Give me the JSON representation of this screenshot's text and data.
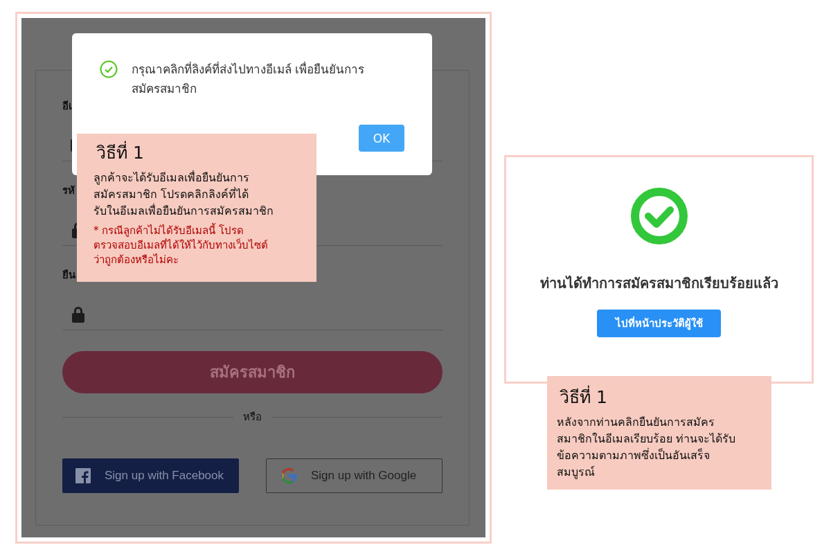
{
  "left_screenshot": {
    "form": {
      "fields": [
        {
          "label": "อีเ",
          "kind": "email"
        },
        {
          "label": "รหั",
          "kind": "password"
        },
        {
          "label": "ยืน",
          "kind": "password"
        }
      ],
      "submit_button": "สมัครสมาชิก",
      "divider_text": "หรือ",
      "social_buttons": [
        {
          "kind": "facebook",
          "label": "Sign up with Facebook"
        },
        {
          "kind": "google",
          "label": "Sign up with Google"
        }
      ]
    },
    "modal": {
      "message": "กรุณาคลิกที่ลิงค์ที่ส่งไปทางอีเมล์ เพื่อยืนยันการ\nสมัครสมาชิก",
      "ok_button": "OK"
    },
    "annotation": {
      "title": "วิธีที่ 1",
      "body": "ลูกค้าจะได้รับอีเมลเพื่อยืนยันการ\nสมัครสมาชิก โปรดคลิกลิงค์ที่ได้\nรับในอีเมลเพื่อยืนยันการสมัครสมาชิก",
      "note": "* กรณีลูกค้าไม่ได้รับอีเมลนี้ โปรด\nตรวจสอบอีเมลที่ได้ให้ไว้กับทางเว็บไซต์\nว่าถูกต้องหรือไม่คะ"
    }
  },
  "right_screenshot": {
    "message": "ท่านได้ทำการสมัครสมาชิกเรียบร้อยแล้ว",
    "button": "ไปที่หน้าประวัติผู้ใช้"
  },
  "right_annotation": {
    "title": "วิธีที่ 1",
    "body": "หลังจากท่านคลิกยืนยันการสมัคร\nสมาชิกในอีเมลเรียบร้อย ท่านจะได้รับ\nข้อความตามภาพซึ่งเป็นอันเสร็จ\nสมบูรณ์"
  }
}
